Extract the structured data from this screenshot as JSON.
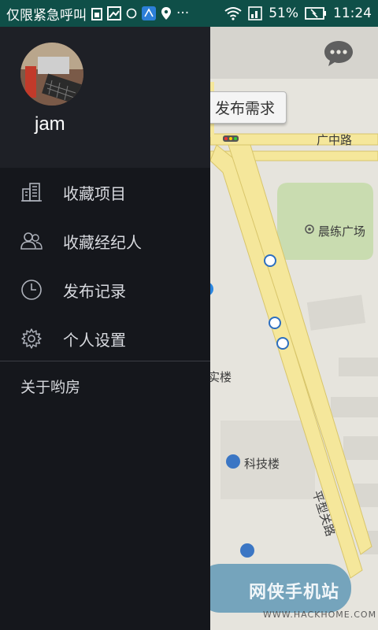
{
  "status_bar": {
    "carrier_text": "仅限紧急呼叫",
    "battery_percent": "51%",
    "time": "11:24",
    "more": "···"
  },
  "map": {
    "publish_button": "发布需求",
    "road_label": "广中路",
    "park_label": "晨练广场",
    "building_label_1": "实楼",
    "building_label_2": "科技楼",
    "road_label_2": "平型关路"
  },
  "drawer": {
    "username": "jam",
    "menu": [
      {
        "label": "收藏项目",
        "icon": "building-icon"
      },
      {
        "label": "收藏经纪人",
        "icon": "people-icon"
      },
      {
        "label": "发布记录",
        "icon": "clock-icon"
      },
      {
        "label": "个人设置",
        "icon": "gear-icon"
      }
    ],
    "about": "关于哟房"
  },
  "watermark": {
    "logo": "网侠手机站",
    "url": "WWW.HACKHOME.COM"
  },
  "colors": {
    "status_bar": "#0f4f48",
    "drawer": "#15171c",
    "drawer_header": "#1e2026",
    "map_road": "#f5e79b",
    "map_park": "#c9dcb0"
  }
}
